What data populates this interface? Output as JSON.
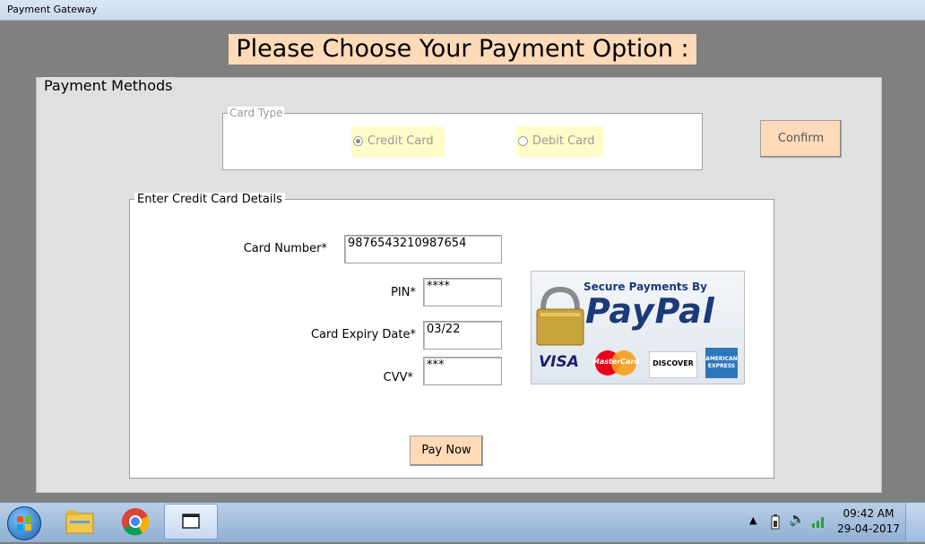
{
  "window": {
    "title": "Payment Gateway"
  },
  "heading": "Please Choose Your Payment Option :",
  "payment_methods": {
    "legend": "Payment Methods",
    "card_type": {
      "legend": "Card Type",
      "options": [
        {
          "label": "Credit Card",
          "selected": true
        },
        {
          "label": "Debit Card",
          "selected": false
        }
      ]
    },
    "confirm_label": "Confirm"
  },
  "details": {
    "legend": "Enter Credit Card Details",
    "card_number_label": "Card Number*",
    "card_number_value": "9876543210987654",
    "pin_label": "PIN*",
    "pin_value": "****",
    "expiry_label": "Card Expiry Date*",
    "expiry_value": "03/22",
    "cvv_label": "CVV*",
    "cvv_value": "***",
    "pay_now_label": "Pay Now"
  },
  "paypal_banner": {
    "tagline": "Secure Payments By",
    "brand": "PayPal",
    "cards": [
      "VISA",
      "MasterCard",
      "DISCOVER",
      "AMERICAN EXPRESS"
    ]
  },
  "colors": {
    "accent": "#ffdab9",
    "radio_bg": "#fffcc8",
    "paypal_dark": "#1a3a7a",
    "paypal_light": "#2a8fd8"
  },
  "taskbar": {
    "pinned_icons": [
      "start-orb-icon",
      "file-explorer-icon",
      "chrome-icon",
      "window-app-icon"
    ],
    "tray_icons": [
      "chevron-up-icon",
      "battery-icon",
      "speaker-icon",
      "network-icon"
    ],
    "time": "09:42 AM",
    "date": "29-04-2017"
  }
}
